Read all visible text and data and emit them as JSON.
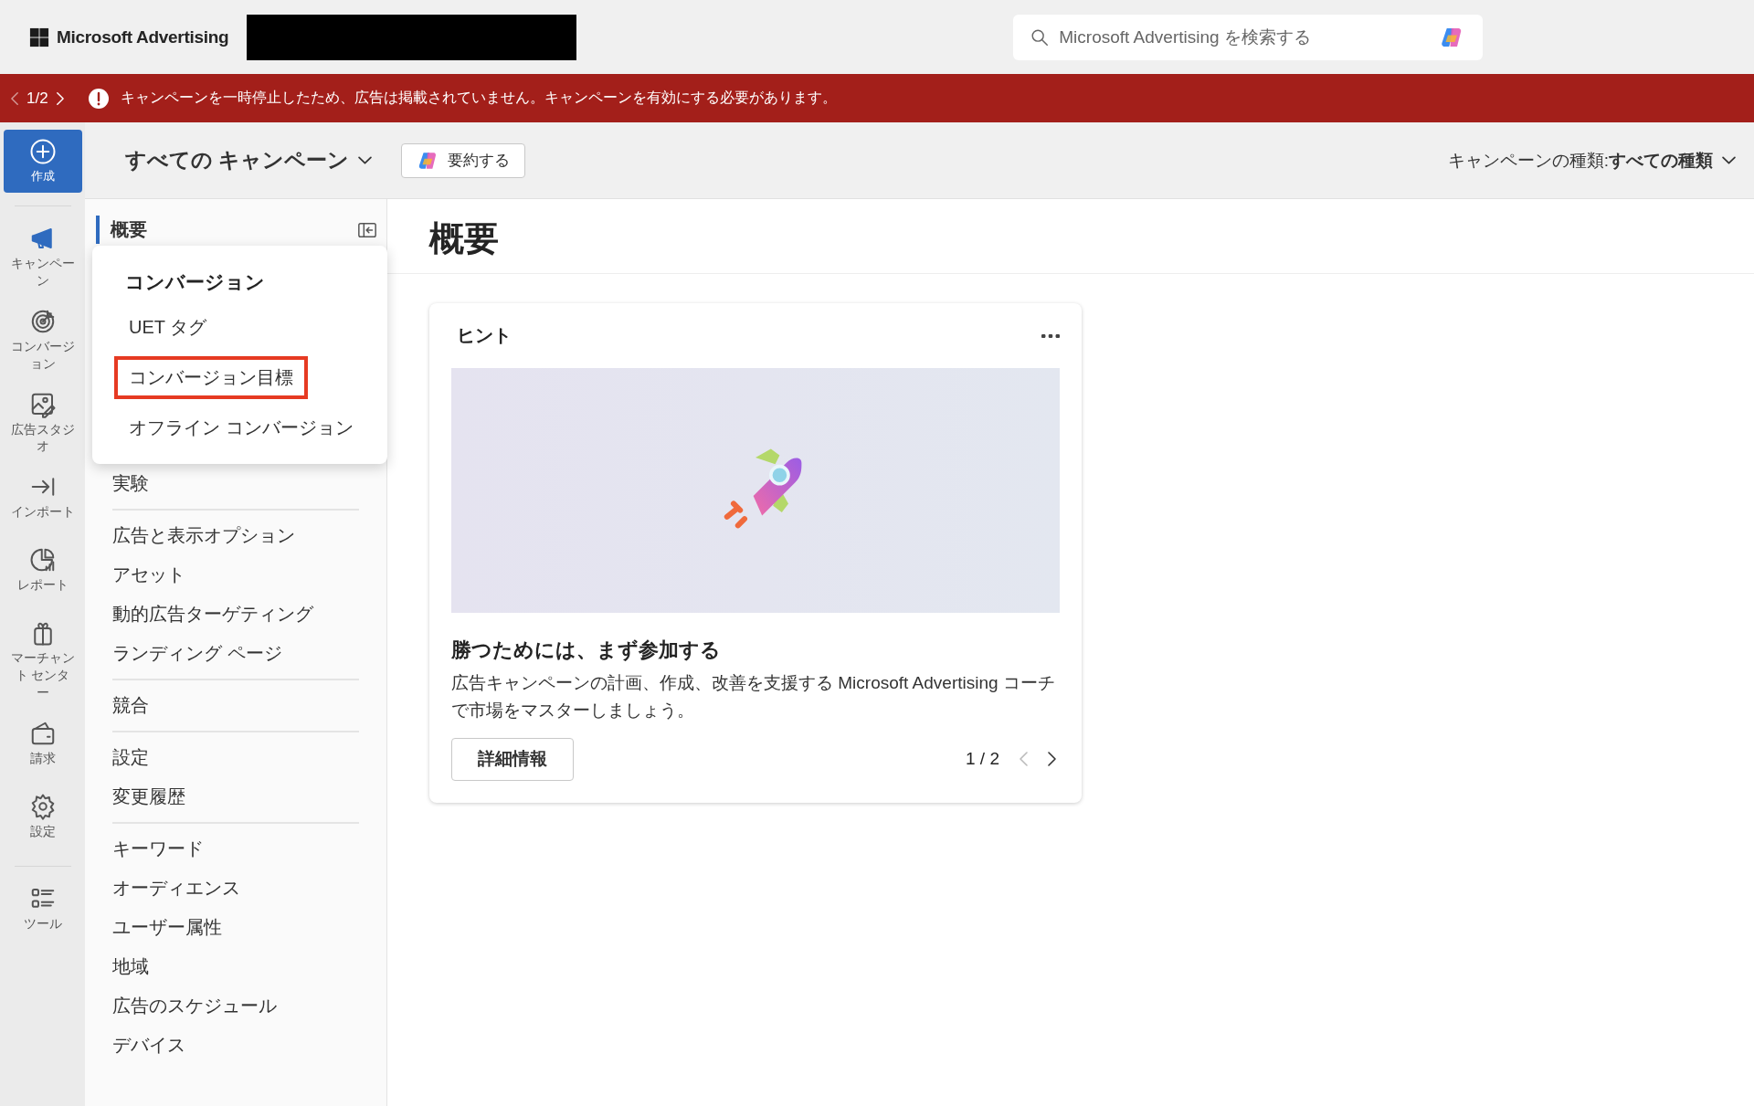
{
  "top_bar": {
    "logo_text": "Microsoft Advertising",
    "search": {
      "placeholder": "Microsoft Advertising を検索する"
    }
  },
  "alert_banner": {
    "pager": "1/2",
    "message": "キャンペーンを一時停止したため、広告は掲載されていません。キャンペーンを有効にする必要があります。"
  },
  "rail": {
    "create_label": "作成",
    "items": [
      {
        "label": "キャンペーン",
        "selected": true
      },
      {
        "label": "コンバージョン",
        "selected": false
      },
      {
        "label": "広告スタジオ",
        "selected": false
      },
      {
        "label": "インポート",
        "selected": false
      },
      {
        "label": "レポート",
        "selected": false
      },
      {
        "label": "マーチャント センター",
        "selected": false
      },
      {
        "label": "請求",
        "selected": false
      },
      {
        "label": "設定",
        "selected": false
      },
      {
        "label": "ツール",
        "selected": false
      }
    ]
  },
  "toolbar": {
    "title": "すべての キャンペーン",
    "summarize_button": "要約する",
    "campaign_type": "キャンペーンの種類:**すべての種類**"
  },
  "nav": {
    "top_item": {
      "label": "概要",
      "selected": true
    },
    "flyout": {
      "heading": "コンバージョン",
      "items": [
        {
          "label": "UET タグ",
          "annotated": false
        },
        {
          "label": "コンバージョン目標",
          "annotated": true
        },
        {
          "label": "オフライン コンバージョン",
          "annotated": false
        }
      ]
    },
    "groups": [
      [
        "実験"
      ],
      [
        "広告と表示オプション",
        "アセット",
        "動的広告ターゲティング",
        "ランディング ページ"
      ],
      [
        "競合"
      ],
      [
        "設定",
        "変更履歴"
      ],
      [
        "キーワード",
        "オーディエンス",
        "ユーザー属性",
        "地域",
        "広告のスケジュール",
        "デバイス"
      ]
    ]
  },
  "main": {
    "title": "概要",
    "tip_card": {
      "title": "ヒント",
      "headline": "勝つためには、まず参加する",
      "body": "広告キャンペーンの計画、作成、改善を支援する Microsoft Advertising コーチで市場をマスターしましょう。",
      "button": "詳細情報",
      "pager": "1 / 2"
    }
  }
}
